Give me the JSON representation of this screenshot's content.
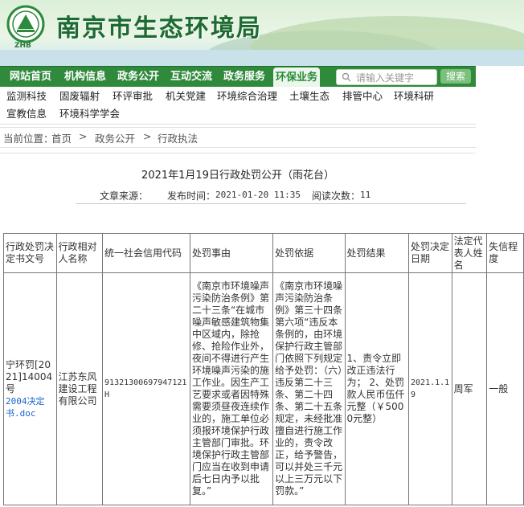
{
  "header": {
    "site_title": "南京市生态环境局",
    "logo_text": "ZHB"
  },
  "main_nav": {
    "items": [
      "网站首页",
      "机构信息",
      "政务公开",
      "互动交流",
      "政务服务",
      "环保业务"
    ],
    "active": "环保业务",
    "search_placeholder": "请输入关键字",
    "search_button": "搜索"
  },
  "sub_nav": {
    "row1": [
      "监测科技",
      "固废辐射",
      "环评审批",
      "机关党建",
      "环境综合治理",
      "土壤生态",
      "排管中心",
      "环境科研"
    ],
    "row2": [
      "宣教信息",
      "环境科学学会"
    ]
  },
  "breadcrumb": {
    "label": "当前位置：",
    "items": [
      "首页",
      "政务公开",
      "行政执法"
    ],
    "sep": ">"
  },
  "article": {
    "title": "2021年1月19日行政处罚公开（雨花台）",
    "source_label": "文章来源：",
    "time_label": "发布时间：",
    "time_value": "2021-01-20 11:35",
    "views_label": "阅读次数：",
    "views_value": "11"
  },
  "table": {
    "headers": [
      "行政处罚决定书文号",
      "行政相对人名称",
      "统一社会信用代码",
      "处罚事由",
      "处罚依据",
      "处罚结果",
      "处罚决定日期",
      "法定代表人姓名",
      "失信程度"
    ],
    "row": {
      "doc_no": "宁环罚[2021]14004号",
      "doc_link": "2004决定书.doc",
      "party": "江苏东风建设工程有限公司",
      "credit_code": "91321300697947121H",
      "reason": "《南京市环境噪声污染防治条例》第二十三条“在城市噪声敏感建筑物集中区域内，除抢修、抢险作业外，夜间不得进行产生环境噪声污染的施工作业。因生产工艺要求或者因特殊需要须昼夜连续作业的，施工单位必须报环境保护行政主管部门审批。环境保护行政主管部门应当在收到申请后七日内予以批复。”",
      "basis": "《南京市环境噪声污染防治条例》第三十四条第六项“违反本条例的，由环境保护行政主管部门依照下列规定给予处罚：（六）违反第二十三条、第二十四条、第二十五条规定，未经批准擅自进行施工作业的，责令改正，给予警告，可以并处三千元以上三万元以下罚款。”",
      "result": "1、责令立即改正违法行为；    2、处罚款人民币伍仟元整（￥5000元整）",
      "date": "2021.1.19",
      "legal_rep": "周军",
      "credit_level": "一般"
    }
  }
}
